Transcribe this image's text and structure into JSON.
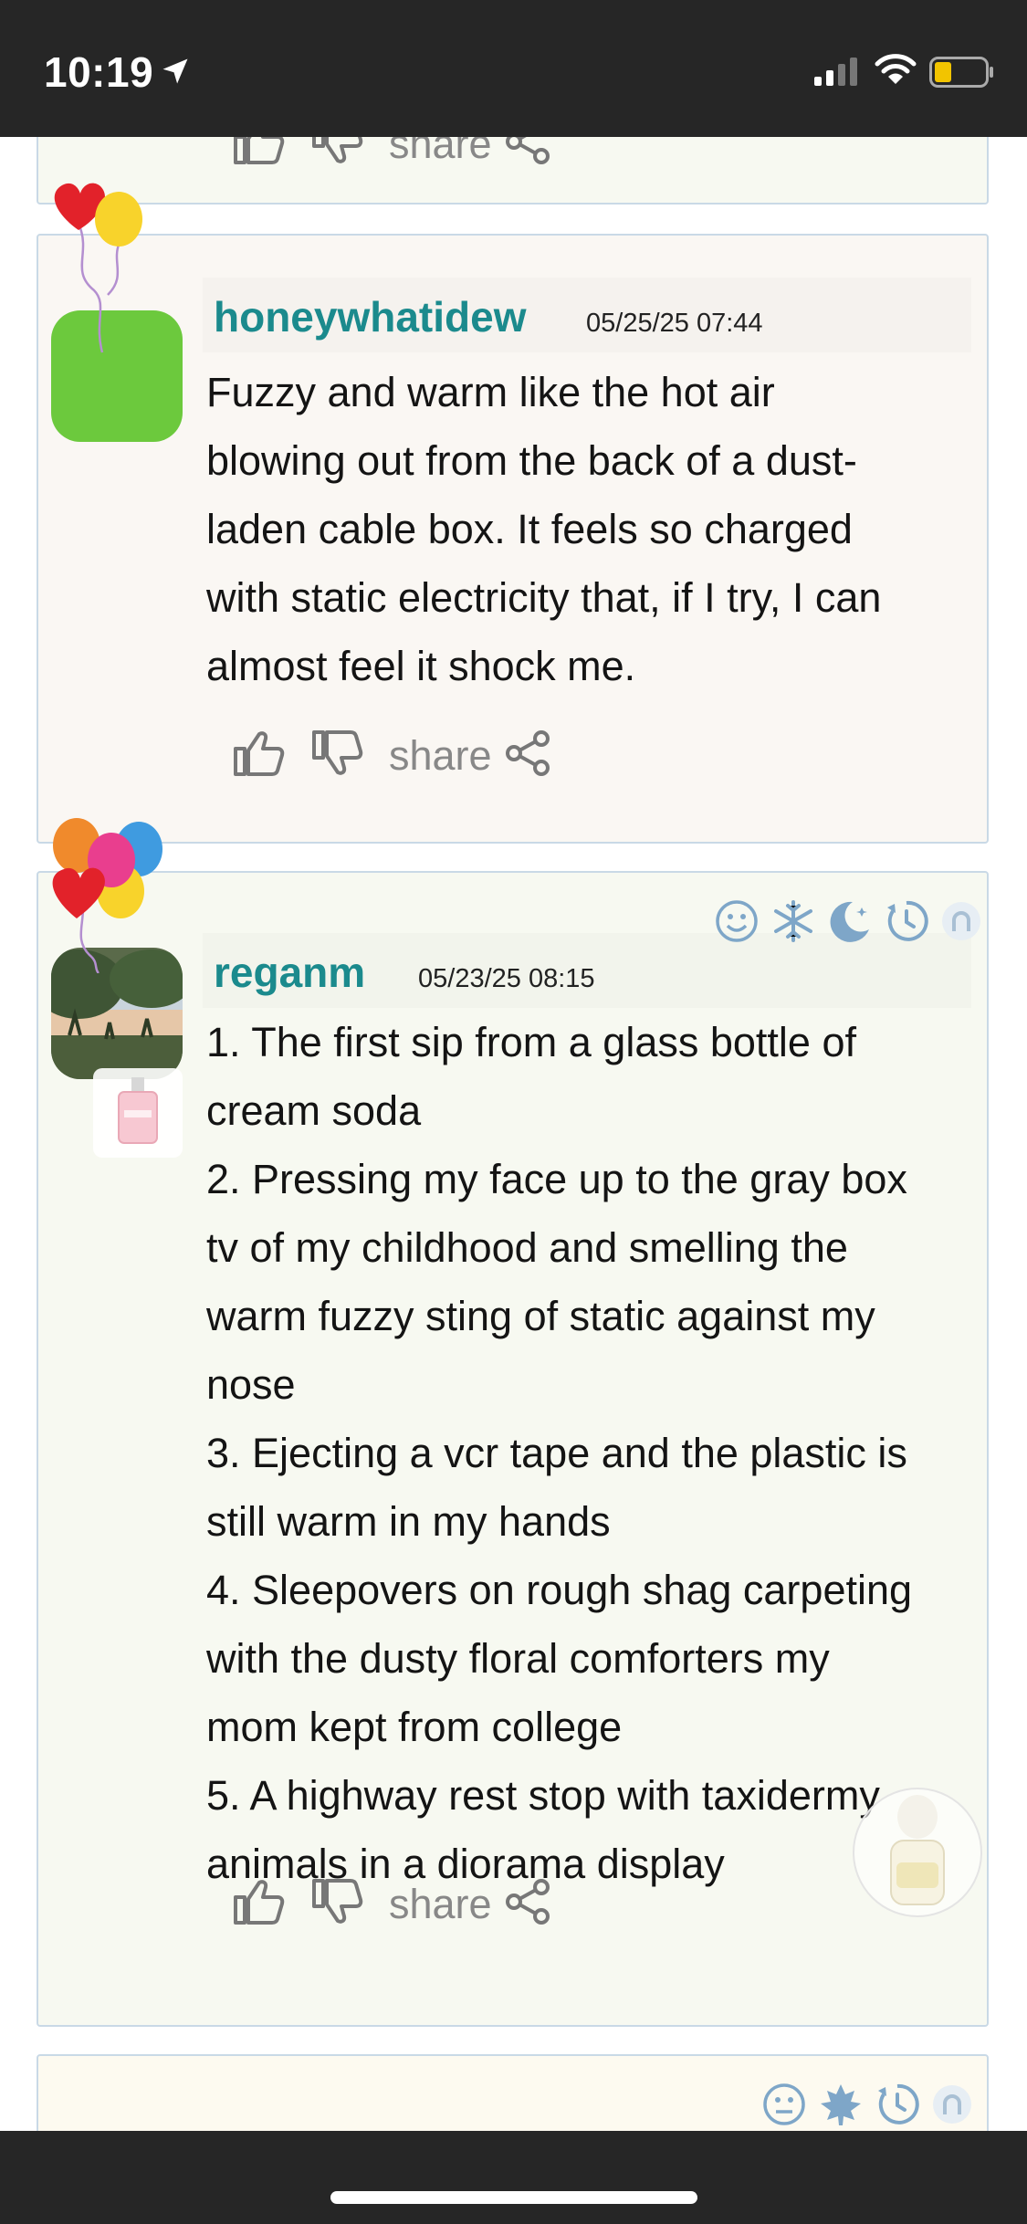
{
  "status_bar": {
    "time": "10:19"
  },
  "posts": [
    {
      "username": "honeywhatidew",
      "timestamp": "05/25/25 07:44",
      "avatar_color": "#6cc93d",
      "body_lines": [
        "Fuzzy and warm like the hot air",
        "blowing out from the back of a dust-",
        "laden cable box. It feels so charged",
        "with static electricity that, if I try, I can",
        "almost feel it shock me."
      ],
      "share_label": "share"
    },
    {
      "username": "reganm",
      "timestamp": "05/23/25 08:15",
      "body_lines": [
        "1. The first sip from a glass bottle of",
        "cream soda",
        "2. Pressing my face up to the gray box",
        "tv of my childhood and smelling the",
        "warm fuzzy sting of static against my",
        "nose",
        "3. Ejecting a vcr tape and the plastic is",
        "still warm in my hands",
        "4. Sleepovers on rough shag carpeting",
        "with the dusty floral comforters my",
        "mom kept from college",
        "5. A highway rest stop with taxidermy",
        "animals in a diorama display"
      ],
      "share_label": "share",
      "badges": [
        "smiley-icon",
        "snowflake-icon",
        "moon-stars-icon",
        "clock-icon",
        "horseshoe-icon"
      ]
    }
  ],
  "partial_top_card": {
    "share_label": "share"
  },
  "partial_bottom_card": {
    "badges": [
      "neutral-face-icon",
      "maple-leaf-icon",
      "clock-icon",
      "horseshoe-icon"
    ]
  },
  "colors": {
    "username": "#1b8a8d",
    "card_border": "#c9d9e6",
    "icon_gray": "#777777",
    "badge_blue": "#7ea6c8"
  }
}
